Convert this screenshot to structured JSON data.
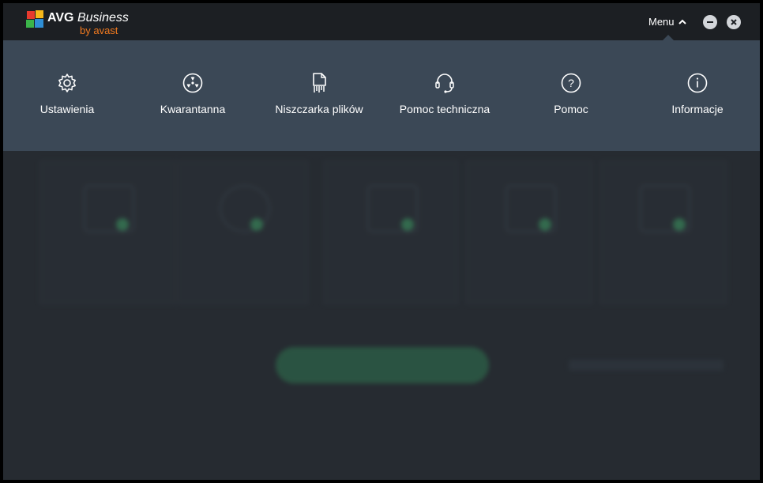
{
  "app": {
    "brand_name": "AVG",
    "brand_product": "Business",
    "brand_byline": "by avast",
    "accent_color": "#f27a1f"
  },
  "titlebar": {
    "menu_label": "Menu",
    "minimize_icon": "minus-icon",
    "close_icon": "close-icon"
  },
  "menu": {
    "items": [
      {
        "label": "Ustawienia",
        "icon": "gear-icon"
      },
      {
        "label": "Kwarantanna",
        "icon": "radiation-icon"
      },
      {
        "label": "Niszczarka plików",
        "icon": "file-shredder-icon"
      },
      {
        "label": "Pomoc techniczna",
        "icon": "headset-icon"
      },
      {
        "label": "Pomoc",
        "icon": "question-icon"
      },
      {
        "label": "Informacje",
        "icon": "info-icon"
      }
    ]
  }
}
